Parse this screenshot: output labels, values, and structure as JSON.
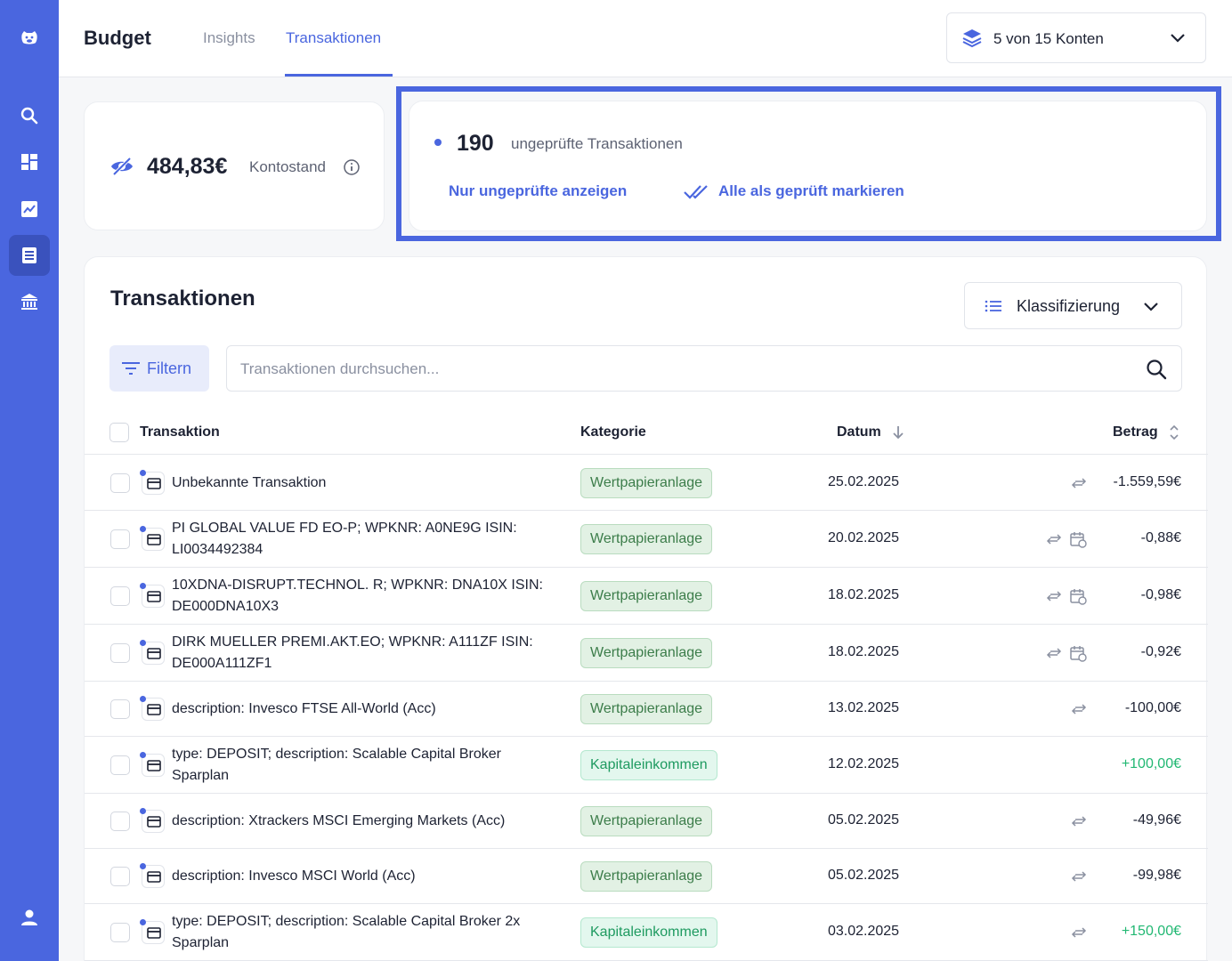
{
  "sidebar": {
    "items": [
      {
        "name": "logo-icon"
      },
      {
        "name": "search-icon"
      },
      {
        "name": "dashboard-icon"
      },
      {
        "name": "chart-icon"
      },
      {
        "name": "transactions-icon",
        "active": true
      },
      {
        "name": "bank-icon"
      },
      {
        "name": "user-icon"
      }
    ]
  },
  "header": {
    "brand": "Budget",
    "tabs": [
      {
        "label": "Insights",
        "active": false
      },
      {
        "label": "Transaktionen",
        "active": true
      }
    ],
    "accounts_label": "5 von 15 Konten"
  },
  "balance": {
    "amount": "484,83€",
    "label": "Kontostand"
  },
  "unreviewed": {
    "count": "190",
    "label": "ungeprüfte Transaktionen",
    "show_only_label": "Nur ungeprüfte anzeigen",
    "mark_all_label": "Alle als geprüft markieren"
  },
  "transactions": {
    "title": "Transaktionen",
    "classification_label": "Klassifizierung",
    "filter_label": "Filtern",
    "search_placeholder": "Transaktionen durchsuchen...",
    "columns": {
      "transaction": "Transaktion",
      "category": "Kategorie",
      "date": "Datum",
      "amount": "Betrag"
    },
    "rows": [
      {
        "description": "Unbekannte Transaktion",
        "category": "Wertpapieranlage",
        "date": "25.02.2025",
        "amount": "-1.559,59€",
        "scheduled": false
      },
      {
        "description": "PI GLOBAL VALUE FD EO-P; WPKNR: A0NE9G ISIN: LI0034492384",
        "category": "Wertpapieranlage",
        "date": "20.02.2025",
        "amount": "-0,88€",
        "scheduled": true
      },
      {
        "description": "10XDNA-DISRUPT.TECHNOL. R; WPKNR: DNA10X ISIN: DE000DNA10X3",
        "category": "Wertpapieranlage",
        "date": "18.02.2025",
        "amount": "-0,98€",
        "scheduled": true
      },
      {
        "description": "DIRK MUELLER PREMI.AKT.EO; WPKNR: A111ZF ISIN: DE000A111ZF1",
        "category": "Wertpapieranlage",
        "date": "18.02.2025",
        "amount": "-0,92€",
        "scheduled": true
      },
      {
        "description": "description: Invesco FTSE All-World (Acc)",
        "category": "Wertpapieranlage",
        "date": "13.02.2025",
        "amount": "-100,00€",
        "scheduled": false
      },
      {
        "description": "type: DEPOSIT; description: Scalable Capital Broker Sparplan",
        "category": "Kapitaleinkommen",
        "date": "12.02.2025",
        "amount": "+100,00€",
        "scheduled": false
      },
      {
        "description": "description: Xtrackers MSCI Emerging Markets (Acc)",
        "category": "Wertpapieranlage",
        "date": "05.02.2025",
        "amount": "-49,96€",
        "scheduled": false
      },
      {
        "description": "description: Invesco MSCI World (Acc)",
        "category": "Wertpapieranlage",
        "date": "05.02.2025",
        "amount": "-99,98€",
        "scheduled": false
      },
      {
        "description": "type: DEPOSIT; description: Scalable Capital Broker 2x Sparplan",
        "category": "Kapitaleinkommen",
        "date": "03.02.2025",
        "amount": "+150,00€",
        "scheduled": false
      }
    ]
  },
  "colors": {
    "accent": "#4a66df",
    "positive": "#22b873",
    "invest_badge": "#e2f1e4",
    "income_badge": "#e3f7ee"
  }
}
